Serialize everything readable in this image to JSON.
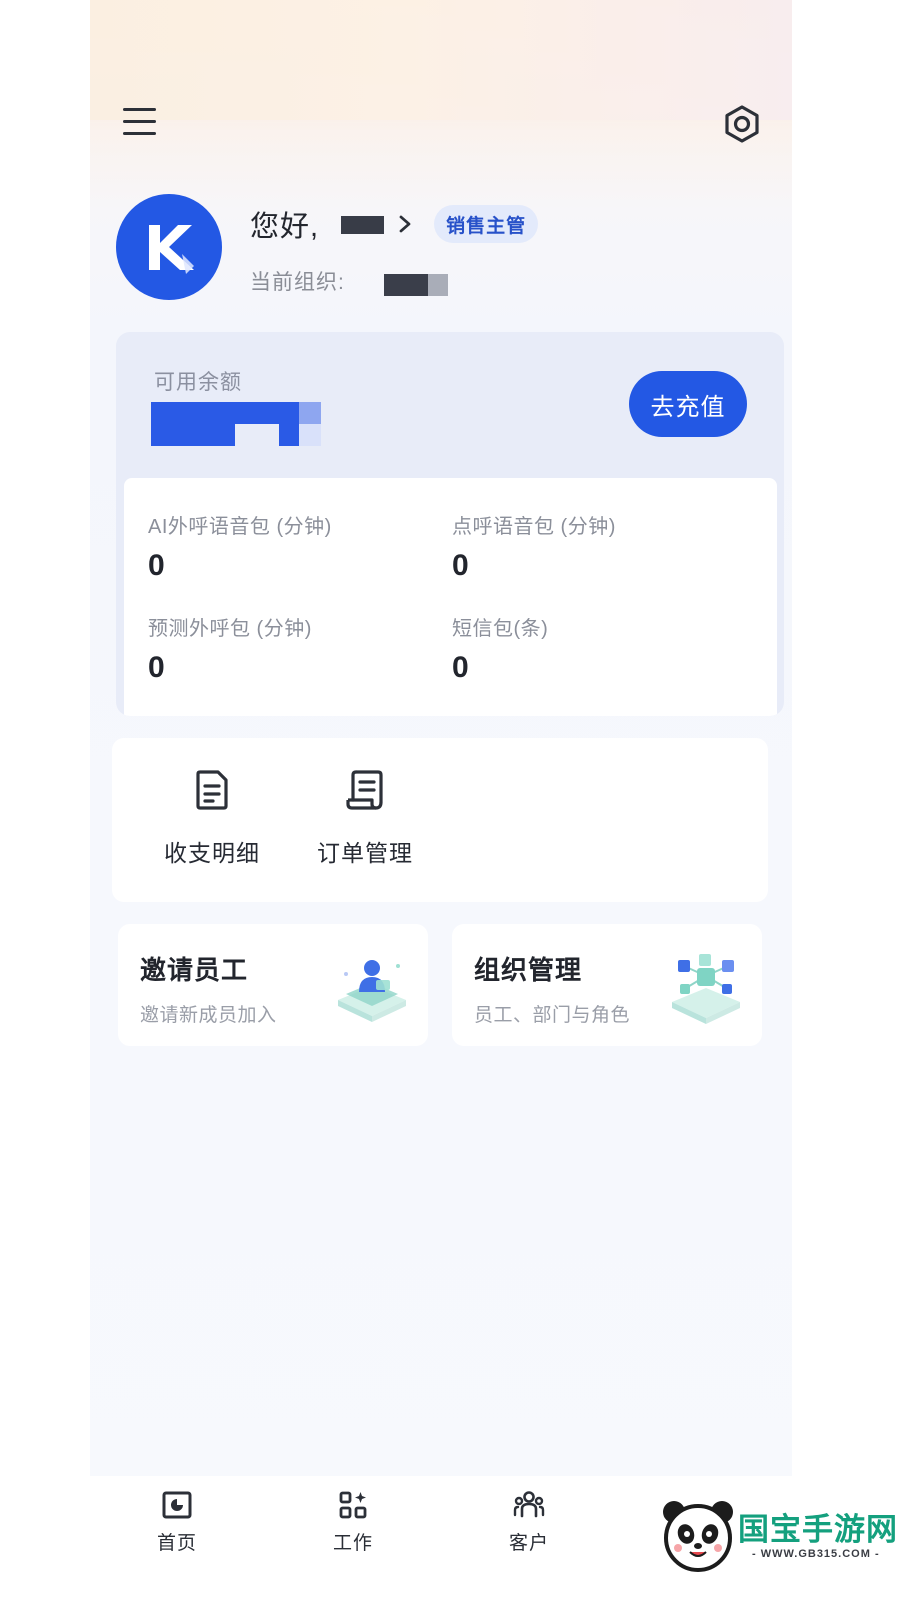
{
  "header": {
    "menu_icon": "hamburger-menu-icon",
    "settings_icon": "hexagon-settings-icon"
  },
  "profile": {
    "greeting": "您好,",
    "role_badge": "销售主管",
    "org_label": "当前组织:",
    "avatar_icon": "k-logo-avatar"
  },
  "balance": {
    "label": "可用余额",
    "recharge_button": "去充值",
    "accent_color": "#2358e4",
    "packages": [
      {
        "label": "AI外呼语音包 (分钟)",
        "value": "0"
      },
      {
        "label": "点呼语音包 (分钟)",
        "value": "0"
      },
      {
        "label": "预测外呼包 (分钟)",
        "value": "0"
      },
      {
        "label": "短信包(条)",
        "value": "0"
      }
    ]
  },
  "quick_actions": [
    {
      "label": "收支明细",
      "icon": "document-icon"
    },
    {
      "label": "订单管理",
      "icon": "receipt-scroll-icon"
    }
  ],
  "features": [
    {
      "title": "邀请员工",
      "subtitle": "邀请新成员加入",
      "icon": "invite-staff-illustration"
    },
    {
      "title": "组织管理",
      "subtitle": "员工、部门与角色",
      "icon": "organization-cubes-illustration"
    }
  ],
  "tabbar": [
    {
      "label": "首页",
      "icon": "home-chart-icon"
    },
    {
      "label": "工作",
      "icon": "apps-grid-icon"
    },
    {
      "label": "客户",
      "icon": "customers-group-icon"
    }
  ],
  "watermark": {
    "text": "国宝手游网",
    "url": "- WWW.GB315.COM -"
  }
}
